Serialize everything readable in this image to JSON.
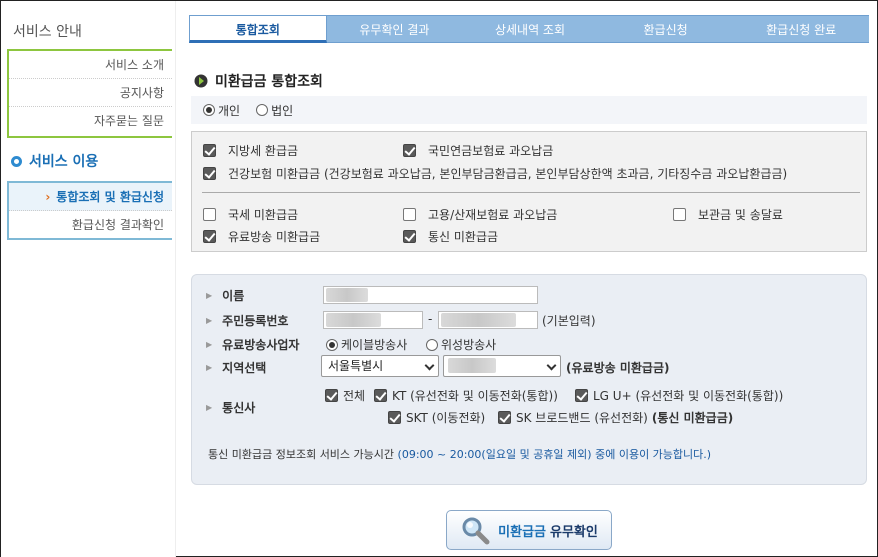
{
  "sidebar": {
    "title": "서비스 안내",
    "group1": [
      "서비스 소개",
      "공지사항",
      "자주묻는 질문"
    ],
    "section": "서비스 이용",
    "group2": [
      "통합조회 및 환급신청",
      "환급신청 결과확인"
    ],
    "chevron": "›"
  },
  "steps": [
    "통합조회",
    "유무확인 결과",
    "상세내역 조회",
    "환급신청",
    "환급신청 완료"
  ],
  "page_title": "미환급금 통합조회",
  "user_type": {
    "options": [
      "개인",
      "법인"
    ],
    "selected": "개인"
  },
  "checks": {
    "local_tax": "지방세 환급금",
    "pension": "국민연금보험료 과오납금",
    "health": "건강보험 미환급금 (건강보험료 과오납금, 본인부담금환급금, 본인부담상한액 초과금, 기타징수금 과오납환급금)",
    "national_tax": "국세 미환급금",
    "employment": "고용/산재보험료 과오납금",
    "deposit": "보관금 및 송달료",
    "broadcast": "유료방송 미환급금",
    "telecom": "통신 미환급금"
  },
  "form": {
    "name_label": "이름",
    "rrn_label": "주민등록번호",
    "rrn_dash": "-",
    "rrn_note": "(기본입력)",
    "operator_label": "유료방송사업자",
    "operator_options": [
      "케이블방송사",
      "위성방송사"
    ],
    "operator_selected": "케이블방송사",
    "region_label": "지역선택",
    "region_value": "서울특별시",
    "region_note": "(유료방송 미환급금)",
    "carrier_label": "통신사",
    "carriers": [
      "전체",
      "KT (유선전화 및 이동전화(통합))",
      "LG U+ (유선전화 및 이동전화(통합))",
      "SKT (이동전화)",
      "SK 브로드밴드 (유선전화)"
    ],
    "carrier_note": "(통신 미환급금)",
    "info_prefix": "통신 미환급금 정보조회 서비스 가능시간 ",
    "info_hours": "(09:00 ~ 20:00(일요일 및 공휴일 제외)",
    "info_suffix": " 중에 이용이 가능합니다.)"
  },
  "submit": {
    "highlight": "미환급금",
    "label": "유무확인"
  },
  "colors": {
    "accent": "#1a6fb5",
    "step_bg": "#8fb9e0",
    "green_border": "#8dc63f"
  }
}
